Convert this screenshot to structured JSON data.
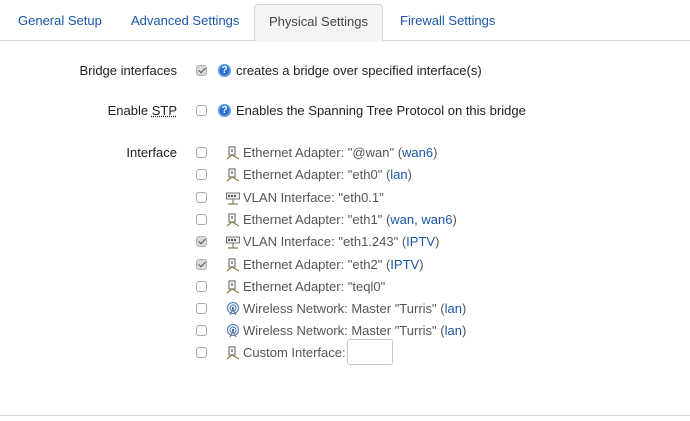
{
  "tabs": [
    {
      "label": "General Setup",
      "active": false
    },
    {
      "label": "Advanced Settings",
      "active": false
    },
    {
      "label": "Physical Settings",
      "active": true
    },
    {
      "label": "Firewall Settings",
      "active": false
    }
  ],
  "bridge": {
    "label": "Bridge interfaces",
    "checked": true,
    "help_icon": "help-icon",
    "description": "creates a bridge over specified interface(s)"
  },
  "stp": {
    "label_prefix": "Enable ",
    "label_abbr": "STP",
    "checked": false,
    "help_icon": "help-icon",
    "description": "Enables the Spanning Tree Protocol on this bridge"
  },
  "interface": {
    "label": "Interface",
    "items": [
      {
        "icon": "ethernet-icon",
        "text": "Ethernet Adapter: \"@wan\"",
        "networks": "wan6",
        "checked": false
      },
      {
        "icon": "ethernet-icon",
        "text": "Ethernet Adapter: \"eth0\"",
        "networks": "lan",
        "checked": false
      },
      {
        "icon": "vlan-icon",
        "text": "VLAN Interface: \"eth0.1\"",
        "networks": "",
        "checked": false
      },
      {
        "icon": "ethernet-icon",
        "text": "Ethernet Adapter: \"eth1\"",
        "networks": "wan, wan6",
        "checked": false
      },
      {
        "icon": "vlan-icon",
        "text": "VLAN Interface: \"eth1.243\"",
        "networks": "IPTV",
        "checked": true
      },
      {
        "icon": "ethernet-icon",
        "text": "Ethernet Adapter: \"eth2\"",
        "networks": "IPTV",
        "checked": true
      },
      {
        "icon": "ethernet-icon",
        "text": "Ethernet Adapter: \"teql0\"",
        "networks": "",
        "checked": false
      },
      {
        "icon": "wireless-icon",
        "text": "Wireless Network: Master \"Turris\"",
        "networks": "lan",
        "checked": false
      },
      {
        "icon": "wireless-icon",
        "text": "Wireless Network: Master \"Turris\"",
        "networks": "lan",
        "checked": false
      }
    ],
    "custom": {
      "icon": "ethernet-icon",
      "label": "Custom Interface:",
      "value": "",
      "checked": false
    }
  },
  "colors": {
    "link": "#1a56a8",
    "help": "#2b6fc7",
    "tab_active_bg": "#f4f4f4"
  }
}
